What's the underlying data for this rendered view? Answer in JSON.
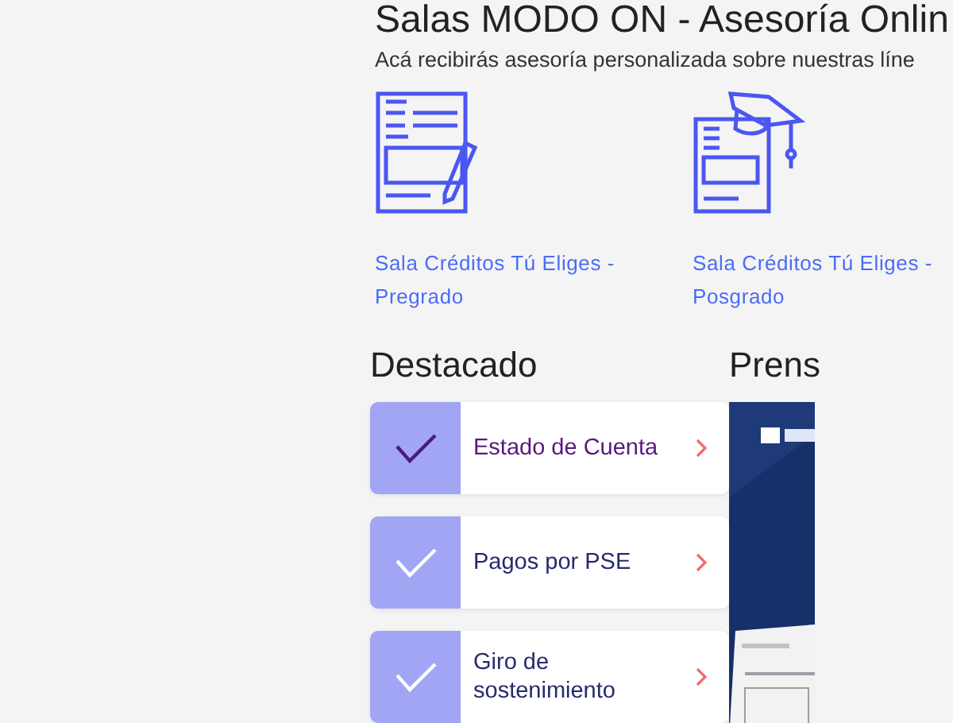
{
  "header": {
    "title": "Salas MODO ON - Asesoría Onlin",
    "subtitle": "Acá recibirás asesoría personalizada sobre nuestras líne"
  },
  "rooms": [
    {
      "kind": "pregrado",
      "label": "Sala Créditos Tú Eliges - Pregrado"
    },
    {
      "kind": "posgrado",
      "label": "Sala Créditos Tú Eliges - Posgrado"
    }
  ],
  "featured": {
    "title": "Destacado",
    "items": [
      {
        "label": "Estado de Cuenta",
        "selected": true
      },
      {
        "label": "Pagos por PSE",
        "selected": false
      },
      {
        "label": "Giro de sostenimiento",
        "selected": false
      }
    ]
  },
  "press": {
    "title": "Prens"
  }
}
